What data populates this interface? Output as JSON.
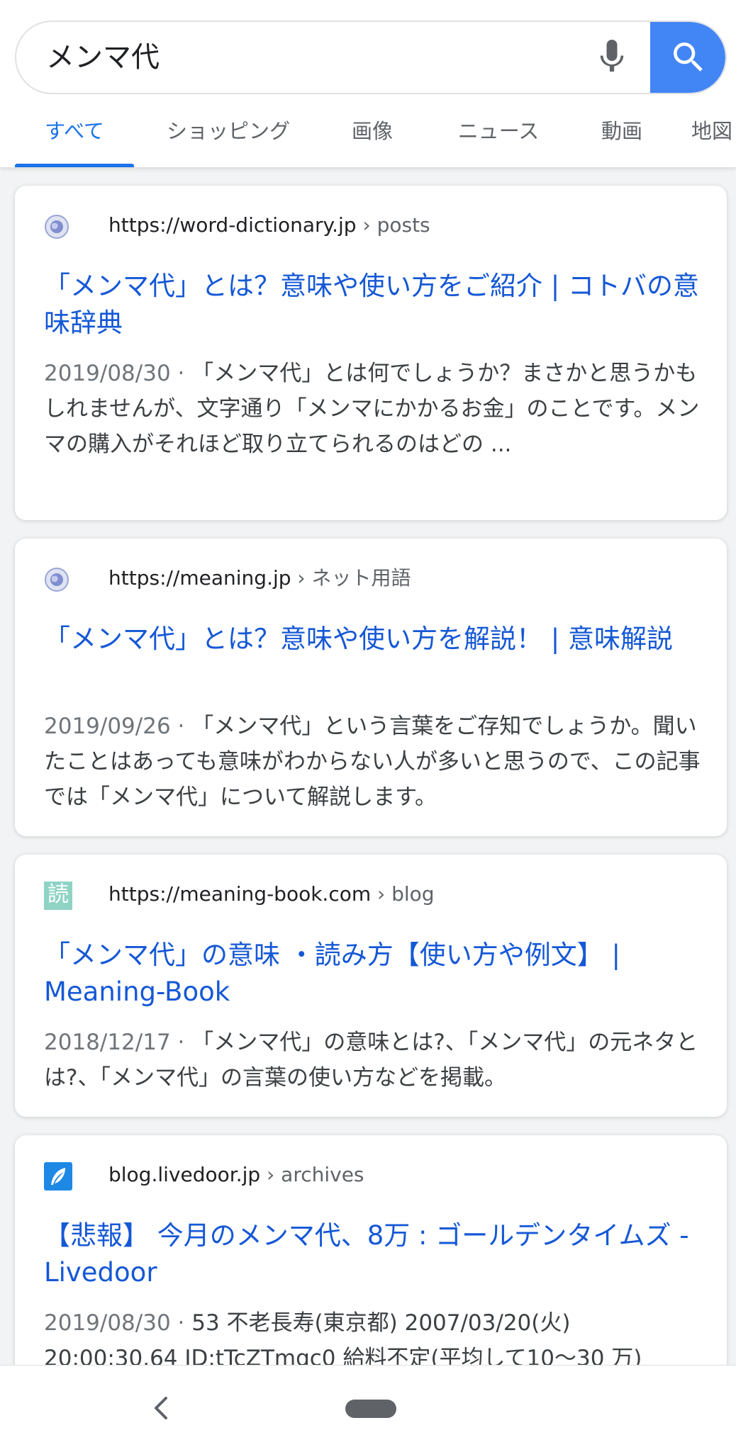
{
  "search": {
    "query": "メンマ代",
    "icons": {
      "mic": "mic-icon",
      "search": "search-icon"
    },
    "accent_color": "#4285f4"
  },
  "tabs": [
    {
      "label": "すべて",
      "active": true
    },
    {
      "label": "ショッピング",
      "active": false
    },
    {
      "label": "画像",
      "active": false
    },
    {
      "label": "ニュース",
      "active": false
    },
    {
      "label": "動画",
      "active": false
    },
    {
      "label": "地図",
      "active": false
    }
  ],
  "results": [
    {
      "favicon": "globe-icon",
      "domain": "https://word-dictionary.jp",
      "path": " › posts",
      "title": "「メンマ代」とは？意味や使い方をご紹介 | コトバの意味辞典",
      "date": "2019/08/30 · ",
      "snippet": "「メンマ代」とは何でしょうか？まさかと思うかもしれませんが、文字通り「メンマにかかるお金」のことです。メンマの購入がそれほど取り立てられるのはどの ..."
    },
    {
      "favicon": "globe-icon",
      "domain": "https://meaning.jp",
      "path": " › ネット用語",
      "title": "「メンマ代」とは？意味や使い方を解説！ | 意味解説",
      "date": "2019/09/26 · ",
      "snippet": "「メンマ代」という言葉をご存知でしょうか。聞いたことはあっても意味がわからない人が多いと思うので、この記事では「メンマ代」について解説します。"
    },
    {
      "favicon": "kanji-yomu-icon",
      "favicon_text": "読",
      "domain": "https://meaning-book.com",
      "path": " › blog",
      "title": "「メンマ代」の意味 ・読み方【使い方や例文】 | Meaning-Book",
      "date": "2018/12/17 · ",
      "snippet": "「メンマ代」の意味とは?、「メンマ代」の元ネタとは?、「メンマ代」の言葉の使い方などを掲載。"
    },
    {
      "favicon": "feather-icon",
      "domain": "blog.livedoor.jp",
      "path": " › archives",
      "title": "【悲報】 今月のメンマ代、8万 : ゴールデンタイムズ - Livedoor",
      "date": "2019/08/30 · ",
      "snippet": "53 不老長寿(東京都) 2007/03/20(火) 20:00:30.64 ID:tTcZTmqc0 給料不定(平均して10〜30 万)"
    }
  ],
  "navbar": {
    "back": "back-icon",
    "home": "home-pill-icon"
  }
}
